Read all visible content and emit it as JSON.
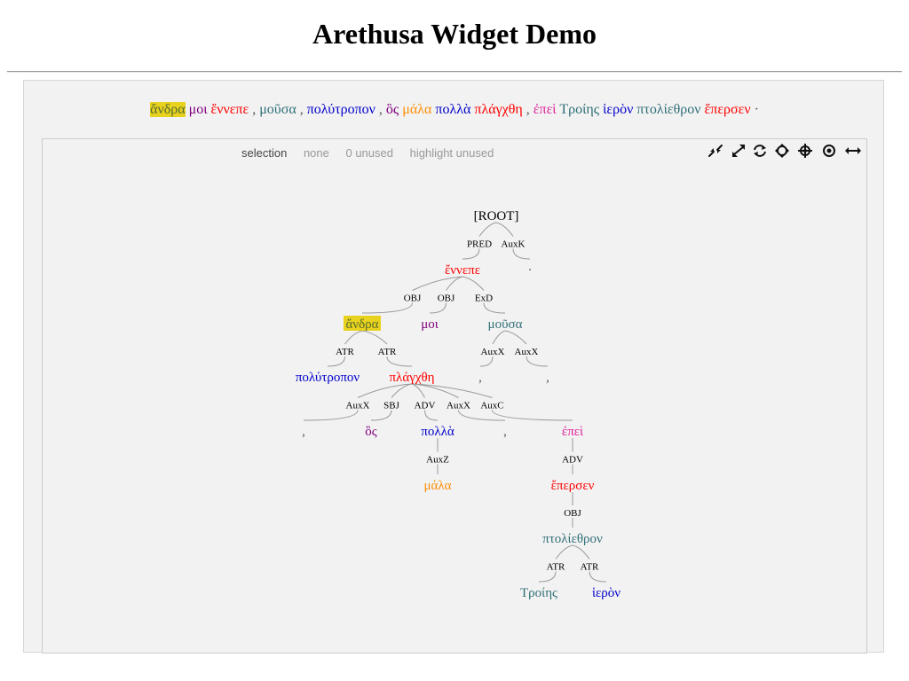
{
  "title": "Arethusa Widget Demo",
  "colors": {
    "highlight": "#e8d21e",
    "edge": "#999999"
  },
  "sentence": [
    {
      "text": "ἄνδρα",
      "color": "#556b2f",
      "highlight": true
    },
    {
      "text": "μοι",
      "color": "#800080"
    },
    {
      "text": "ἔννεπε",
      "color": "#ff0000"
    },
    {
      "text": ",",
      "color": "#555555"
    },
    {
      "text": "μοῦσα",
      "color": "#2f6f77"
    },
    {
      "text": ",",
      "color": "#555555"
    },
    {
      "text": "πολύτροπον",
      "color": "#0000cc"
    },
    {
      "text": ",",
      "color": "#555555"
    },
    {
      "text": "ὃς",
      "color": "#800080"
    },
    {
      "text": "μάλα",
      "color": "#ff8c00"
    },
    {
      "text": "πολλὰ",
      "color": "#0000cc"
    },
    {
      "text": "πλάγχθη",
      "color": "#ff0000"
    },
    {
      "text": ",",
      "color": "#555555"
    },
    {
      "text": "ἐπεὶ",
      "color": "#e0209a"
    },
    {
      "text": "Τροίης",
      "color": "#2f6f77"
    },
    {
      "text": "ἱερὸν",
      "color": "#0000cc"
    },
    {
      "text": "πτολίεθρον",
      "color": "#2f6f77"
    },
    {
      "text": "ἔπερσεν",
      "color": "#ff0000"
    },
    {
      "text": "·",
      "color": "#555555"
    }
  ],
  "status": {
    "selection_label": "selection",
    "selection_value": "none",
    "unused": "0 unused",
    "highlight_unused": "highlight unused"
  },
  "toolbar": [
    {
      "name": "compress-icon"
    },
    {
      "name": "expand-icon"
    },
    {
      "name": "refresh-icon"
    },
    {
      "name": "rotate-icon"
    },
    {
      "name": "crosshair-icon"
    },
    {
      "name": "focus-icon"
    },
    {
      "name": "width-icon"
    }
  ],
  "tree": {
    "nodes": [
      {
        "id": "root",
        "word": "[ROOT]",
        "label": "",
        "color": "#000000"
      },
      {
        "id": "ennepe",
        "word": "ἔννεπε",
        "label": "PRED",
        "color": "#ff0000",
        "parent": "root"
      },
      {
        "id": "dot",
        "word": "·",
        "label": "AuxK",
        "color": "#555555",
        "parent": "root"
      },
      {
        "id": "andra",
        "word": "ἄνδρα",
        "label": "OBJ",
        "color": "#556b2f",
        "parent": "ennepe",
        "highlight": true
      },
      {
        "id": "moi",
        "word": "μοι",
        "label": "OBJ",
        "color": "#800080",
        "parent": "ennepe"
      },
      {
        "id": "mousa",
        "word": "μοῦσα",
        "label": "ExD",
        "color": "#2f6f77",
        "parent": "ennepe"
      },
      {
        "id": "polytropon",
        "word": "πολύτροπον",
        "label": "ATR",
        "color": "#0000cc",
        "parent": "andra"
      },
      {
        "id": "plagchthe",
        "word": "πλάγχθη",
        "label": "ATR",
        "color": "#ff0000",
        "parent": "andra"
      },
      {
        "id": "comma1",
        "word": ",",
        "label": "AuxX",
        "color": "#555555",
        "parent": "mousa"
      },
      {
        "id": "comma2",
        "word": ",",
        "label": "AuxX",
        "color": "#555555",
        "parent": "mousa"
      },
      {
        "id": "comma3",
        "word": ",",
        "label": "AuxX",
        "color": "#555555",
        "parent": "plagchthe"
      },
      {
        "id": "hos",
        "word": "ὃς",
        "label": "SBJ",
        "color": "#800080",
        "parent": "plagchthe"
      },
      {
        "id": "polla",
        "word": "πολλὰ",
        "label": "ADV",
        "color": "#0000cc",
        "parent": "plagchthe"
      },
      {
        "id": "comma4",
        "word": ",",
        "label": "AuxX",
        "color": "#555555",
        "parent": "plagchthe"
      },
      {
        "id": "epei",
        "word": "ἐπεὶ",
        "label": "AuxC",
        "color": "#e0209a",
        "parent": "plagchthe"
      },
      {
        "id": "mala",
        "word": "μάλα",
        "label": "AuxZ",
        "color": "#ff8c00",
        "parent": "polla"
      },
      {
        "id": "epersen",
        "word": "ἔπερσεν",
        "label": "ADV",
        "color": "#ff0000",
        "parent": "epei"
      },
      {
        "id": "ptolietheron",
        "word": "πτολίεθρον",
        "label": "OBJ",
        "color": "#2f6f77",
        "parent": "epersen"
      },
      {
        "id": "troies",
        "word": "Τροίης",
        "label": "ATR",
        "color": "#2f6f77",
        "parent": "ptolietheron"
      },
      {
        "id": "hieron",
        "word": "ἱερὸν",
        "label": "ATR",
        "color": "#0000cc",
        "parent": "ptolietheron"
      }
    ]
  }
}
